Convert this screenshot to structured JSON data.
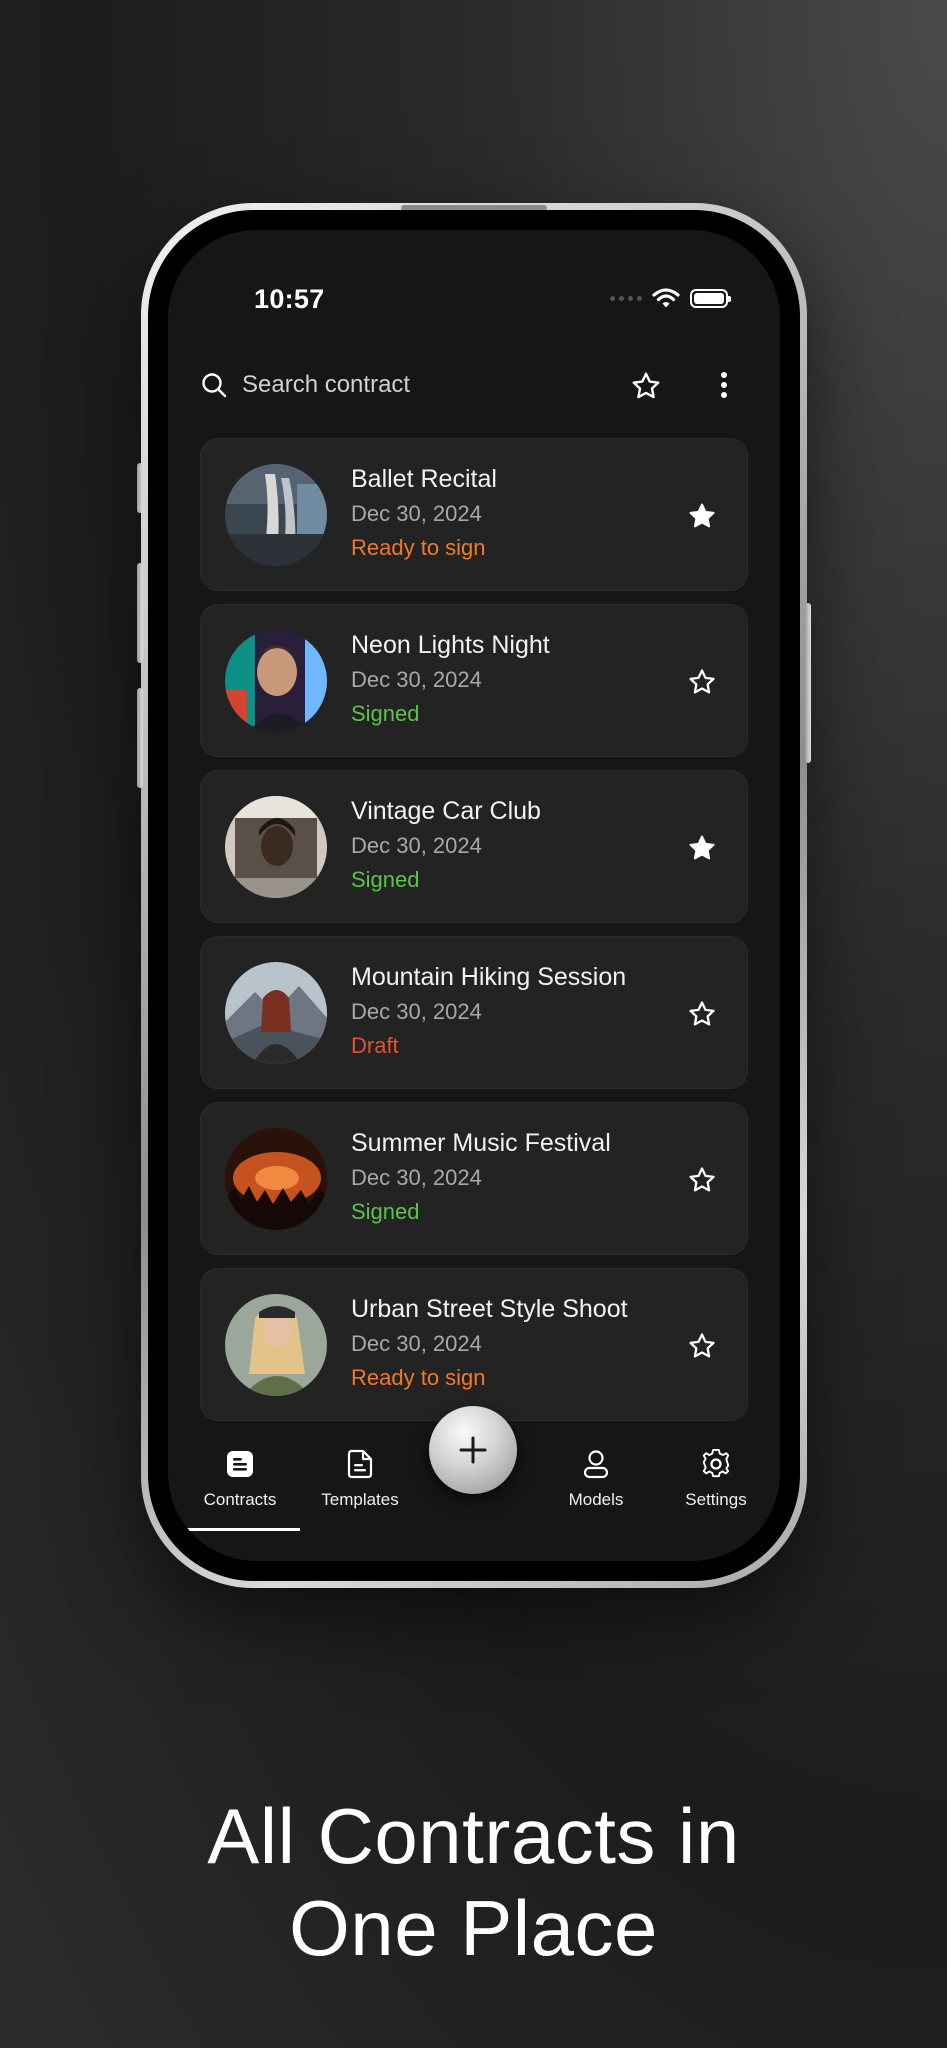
{
  "status_bar": {
    "time": "10:57"
  },
  "search": {
    "placeholder": "Search contract"
  },
  "contracts": [
    {
      "title": "Ballet Recital",
      "date": "Dec 30, 2024",
      "status": "Ready to sign",
      "status_color": "#f07a2a",
      "starred": true,
      "thumbnail": "ballet-shoes-photo"
    },
    {
      "title": "Neon Lights Night",
      "date": "Dec 30, 2024",
      "status": "Signed",
      "status_color": "#5cc24a",
      "starred": false,
      "thumbnail": "neon-portrait-photo"
    },
    {
      "title": "Vintage Car Club",
      "date": "Dec 30, 2024",
      "status": "Signed",
      "status_color": "#5cc24a",
      "starred": true,
      "thumbnail": "car-window-portrait-photo"
    },
    {
      "title": "Mountain Hiking Session",
      "date": "Dec 30, 2024",
      "status": "Draft",
      "status_color": "#e2532f",
      "starred": false,
      "thumbnail": "mountain-hiker-photo"
    },
    {
      "title": "Summer Music Festival",
      "date": "Dec 30, 2024",
      "status": "Signed",
      "status_color": "#5cc24a",
      "starred": false,
      "thumbnail": "concert-crowd-photo"
    },
    {
      "title": "Urban Street Style Shoot",
      "date": "Dec 30, 2024",
      "status": "Ready to sign",
      "status_color": "#f07a2a",
      "starred": false,
      "thumbnail": "street-style-portrait-photo"
    }
  ],
  "tabs": [
    {
      "label": "Contracts",
      "icon": "contract-doc-icon",
      "active": true
    },
    {
      "label": "Templates",
      "icon": "template-doc-icon",
      "active": false
    },
    {
      "label": "Models",
      "icon": "person-icon",
      "active": false
    },
    {
      "label": "Settings",
      "icon": "gear-icon",
      "active": false
    }
  ],
  "fab": {
    "icon": "plus-icon"
  },
  "headline": {
    "line1": "All Contracts in",
    "line2": "One Place"
  }
}
